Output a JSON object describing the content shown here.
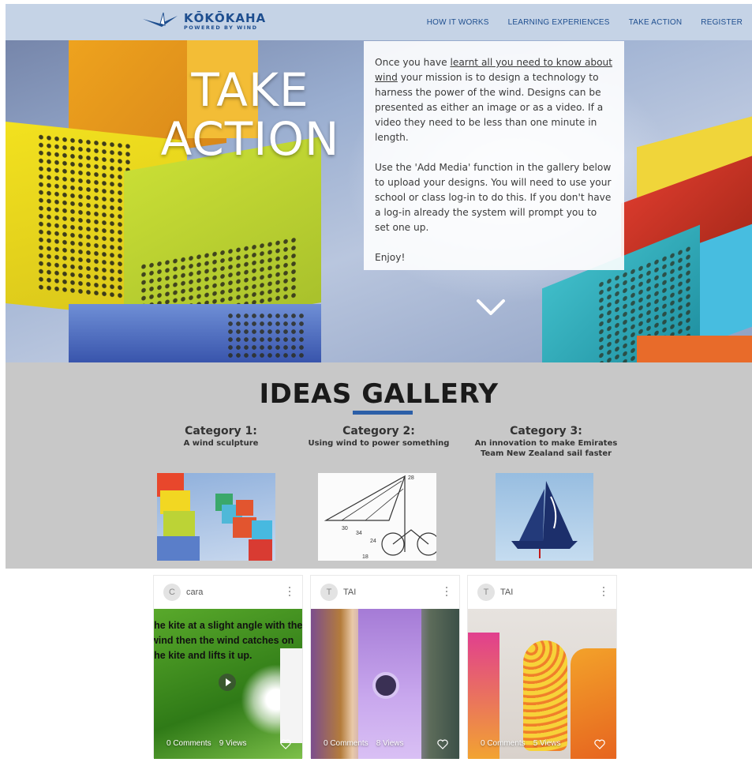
{
  "header": {
    "logo_name": "KŌKŌKAHA",
    "logo_tagline": "POWERED BY WIND",
    "nav": [
      "HOW IT WORKS",
      "LEARNING EXPERIENCES",
      "TAKE ACTION",
      "REGISTER"
    ]
  },
  "hero": {
    "title_line1": "TAKE",
    "title_line2": "ACTION",
    "para1_before_link": "Once you have ",
    "para1_link": "learnt all you need to know about wind",
    "para1_after_link": " your mission is to design a technology to harness the power of the wind. Designs can be presented as either an image or as a video. If a video they need to be less than one minute in length.",
    "para2": "Use the 'Add Media' function in the gallery below to upload your designs. You will need to use your school or class log-in to do this. If you don't have a log-in already the system will prompt you to set one up.",
    "para3": "Enjoy!"
  },
  "gallery": {
    "title": "IDEAS GALLERY",
    "categories": [
      {
        "title": "Category 1:",
        "subtitle": "A wind sculpture"
      },
      {
        "title": "Category 2:",
        "subtitle": "Using wind to power something"
      },
      {
        "title": "Category 3:",
        "subtitle": "An innovation to make Emirates Team New Zealand sail faster"
      }
    ]
  },
  "posts": [
    {
      "avatar": "C",
      "author": "cara",
      "comments": "0 Comments",
      "views": "9 Views",
      "caption": "the kite at a slight angle with the wind then the wind catches on the kite and lifts it up."
    },
    {
      "avatar": "T",
      "author": "TAI",
      "comments": "0 Comments",
      "views": "8 Views"
    },
    {
      "avatar": "T",
      "author": "TAI",
      "comments": "0 Comments",
      "views": "5 Views"
    }
  ],
  "colors": {
    "header_bg": "#c5d3e6",
    "brand_blue": "#1e4e8f",
    "gallery_bg": "#c8c8c8",
    "accent_underline": "#2c5fa8"
  },
  "icons": [
    "logo-bird-icon",
    "chevron-down-icon",
    "more-vertical-icon",
    "heart-icon",
    "play-icon"
  ]
}
